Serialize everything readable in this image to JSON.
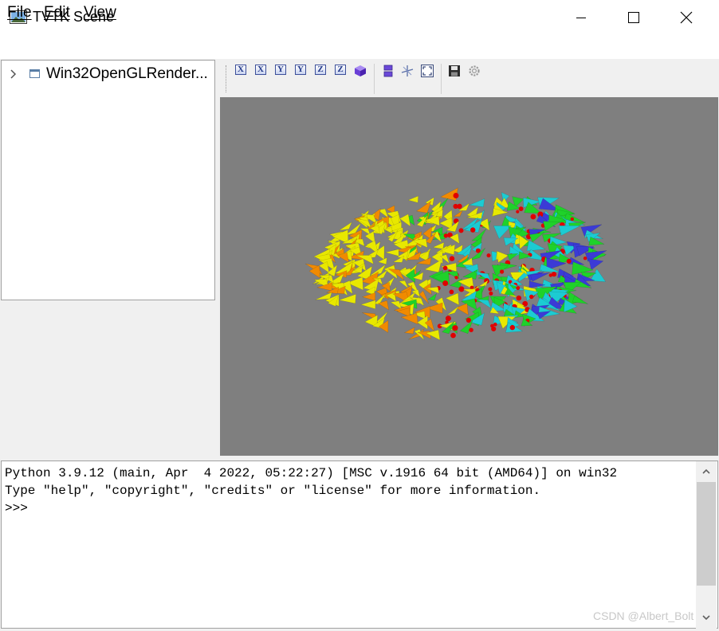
{
  "window": {
    "title": "TVTK Scene",
    "icon": "app-landscape-icon"
  },
  "window_controls": {
    "minimize_icon": "minimize-icon",
    "maximize_icon": "maximize-icon",
    "close_icon": "close-icon"
  },
  "menu": {
    "items": [
      {
        "label": "File"
      },
      {
        "label": "Edit"
      },
      {
        "label": "View"
      }
    ]
  },
  "tree": {
    "expand_icon": "chevron-right-icon",
    "node_icon": "window-icon",
    "node_label": "Win32OpenGLRender..."
  },
  "toolbar": {
    "buttons": [
      {
        "name": "view-plus-x-icon",
        "glyph": "X"
      },
      {
        "name": "view-minus-x-icon",
        "glyph": "X"
      },
      {
        "name": "view-plus-y-icon",
        "glyph": "Y"
      },
      {
        "name": "view-minus-y-icon",
        "glyph": "Y"
      },
      {
        "name": "view-plus-z-icon",
        "glyph": "Z"
      },
      {
        "name": "view-minus-z-icon",
        "glyph": "Z"
      },
      {
        "name": "isometric-view-icon"
      },
      {
        "name": "parallel-projection-icon"
      },
      {
        "name": "axes-indicator-icon"
      },
      {
        "name": "full-screen-icon"
      },
      {
        "name": "save-icon"
      },
      {
        "name": "configure-scene-icon"
      }
    ]
  },
  "viewport": {
    "background": "#7f7f7f",
    "content": "3d-glyph-point-cloud"
  },
  "console": {
    "lines": [
      "Python 3.9.12 (main, Apr  4 2022, 05:22:27) [MSC v.1916 64 bit (AMD64)] on win32",
      "Type \"help\", \"copyright\", \"credits\" or \"license\" for more information.",
      ">>>"
    ]
  },
  "watermark": "CSDN @Albert_Bolt",
  "colors": {
    "titlebar_bg": "#ffffff",
    "window_bg": "#f0f0f0",
    "viewport_bg": "#7f7f7f",
    "glyph_blue": "#3b3bd6",
    "glyph_cyan": "#1ccbd2",
    "glyph_green": "#1fd12a",
    "glyph_yellow": "#e8e800",
    "glyph_orange": "#f08a00",
    "point_red": "#e00000"
  }
}
